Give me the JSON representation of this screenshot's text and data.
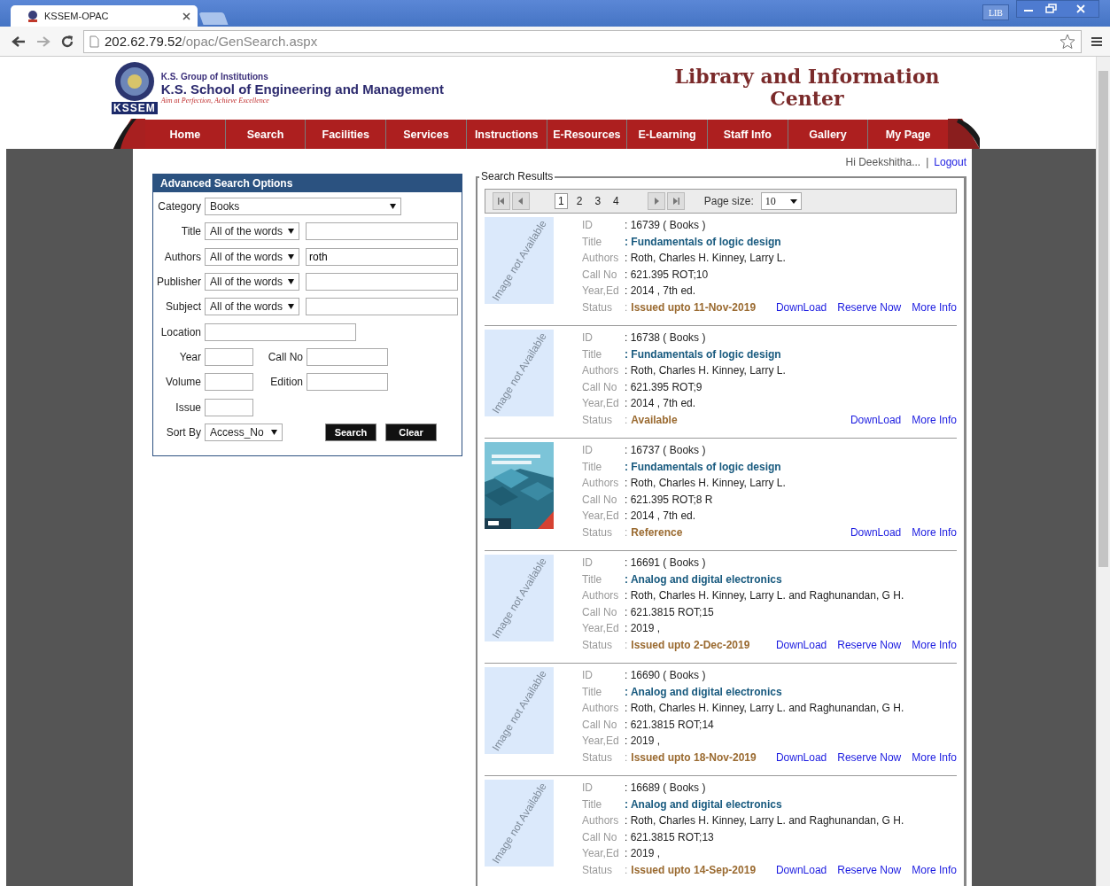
{
  "browser": {
    "tab_title": "KSSEM-OPAC",
    "profile": "LIB",
    "url_host": "202.62.79.52",
    "url_path": "/opac/GenSearch.aspx"
  },
  "header": {
    "group": "K.S. Group of Institutions",
    "school": "K.S. School of Engineering and Management",
    "motto": "Aim at Perfection, Achieve Excellence",
    "logo_text": "KSSEM",
    "title": "Library and Information Center"
  },
  "nav": [
    "Home",
    "Search",
    "Facilities",
    "Services",
    "Instructions",
    "E-Resources",
    "E-Learning",
    "Staff Info",
    "Gallery",
    "My Page"
  ],
  "user": {
    "greeting": "Hi Deekshitha...",
    "separator": "|",
    "logout": "Logout"
  },
  "search_panel": {
    "title": "Advanced Search Options",
    "category": {
      "label": "Category",
      "value": "Books"
    },
    "word_fields": [
      {
        "label": "Title",
        "mode": "All of the words"
      },
      {
        "label": "Authors",
        "mode": "All of the words",
        "value": "roth"
      },
      {
        "label": "Publisher",
        "mode": "All of the words"
      },
      {
        "label": "Subject",
        "mode": "All of the words"
      }
    ],
    "location": {
      "label": "Location"
    },
    "pairs": [
      {
        "left": "Year",
        "right": "Call No"
      },
      {
        "left": "Volume",
        "right": "Edition"
      }
    ],
    "issue": {
      "label": "Issue"
    },
    "sort": {
      "label": "Sort By",
      "value": "Access_No"
    },
    "buttons": [
      "Search",
      "Clear"
    ]
  },
  "results": {
    "legend": "Search Results",
    "pages": [
      {
        "label": "1",
        "selected": true
      },
      {
        "label": "2",
        "selected": false
      },
      {
        "label": "3",
        "selected": false
      },
      {
        "label": "4",
        "selected": false
      }
    ],
    "page_size_label": "Page size:",
    "page_size": "10",
    "items": [
      {
        "image": {
          "kind": "placeholder",
          "text": "Image not Available"
        },
        "fields": [
          {
            "label": "ID",
            "value": ": 16739 ( Books  )"
          },
          {
            "label": "Title",
            "value": ": Fundamentals of logic design"
          },
          {
            "label": "Authors",
            "value": ": Roth, Charles H. Kinney, Larry L."
          },
          {
            "label": "Call No",
            "value": ": 621.395 ROT;10"
          },
          {
            "label": "Year,Ed",
            "value": ": 2014  ,  7th ed."
          }
        ],
        "status": {
          "label": "Status",
          "colon": ":",
          "value": "Issued upto 11-Nov-2019"
        },
        "actions": [
          "DownLoad",
          "Reserve Now",
          "More Info"
        ]
      },
      {
        "image": {
          "kind": "placeholder",
          "text": "Image not Available"
        },
        "fields": [
          {
            "label": "ID",
            "value": ": 16738 ( Books  )"
          },
          {
            "label": "Title",
            "value": ": Fundamentals of logic design"
          },
          {
            "label": "Authors",
            "value": ": Roth, Charles H. Kinney, Larry L."
          },
          {
            "label": "Call No",
            "value": ": 621.395 ROT;9"
          },
          {
            "label": "Year,Ed",
            "value": ": 2014  ,  7th ed."
          }
        ],
        "status": {
          "label": "Status",
          "colon": ":",
          "value": "Available"
        },
        "actions": [
          "DownLoad",
          "More Info"
        ]
      },
      {
        "image": {
          "kind": "picture"
        },
        "fields": [
          {
            "label": "ID",
            "value": ": 16737 ( Books  )"
          },
          {
            "label": "Title",
            "value": ": Fundamentals of logic design"
          },
          {
            "label": "Authors",
            "value": ": Roth, Charles H. Kinney, Larry L."
          },
          {
            "label": "Call No",
            "value": ": 621.395 ROT;8 R"
          },
          {
            "label": "Year,Ed",
            "value": ": 2014  ,  7th ed."
          }
        ],
        "status": {
          "label": "Status",
          "colon": ":",
          "value": "Reference"
        },
        "actions": [
          "DownLoad",
          "More Info"
        ]
      },
      {
        "image": {
          "kind": "placeholder",
          "text": "Image not Available"
        },
        "fields": [
          {
            "label": "ID",
            "value": ": 16691 ( Books  )"
          },
          {
            "label": "Title",
            "value": ": Analog and digital electronics"
          },
          {
            "label": "Authors",
            "value": ": Roth, Charles H. Kinney, Larry L. and Raghunandan, G H."
          },
          {
            "label": "Call No",
            "value": ": 621.3815 ROT;15"
          },
          {
            "label": "Year,Ed",
            "value": ": 2019  ,"
          }
        ],
        "status": {
          "label": "Status",
          "colon": ":",
          "value": "Issued upto 2-Dec-2019"
        },
        "actions": [
          "DownLoad",
          "Reserve Now",
          "More Info"
        ]
      },
      {
        "image": {
          "kind": "placeholder",
          "text": "Image not Available"
        },
        "fields": [
          {
            "label": "ID",
            "value": ": 16690 ( Books  )"
          },
          {
            "label": "Title",
            "value": ": Analog and digital electronics"
          },
          {
            "label": "Authors",
            "value": ": Roth, Charles H. Kinney, Larry L. and Raghunandan, G H."
          },
          {
            "label": "Call No",
            "value": ": 621.3815 ROT;14"
          },
          {
            "label": "Year,Ed",
            "value": ": 2019  ,"
          }
        ],
        "status": {
          "label": "Status",
          "colon": ":",
          "value": "Issued upto 18-Nov-2019"
        },
        "actions": [
          "DownLoad",
          "Reserve Now",
          "More Info"
        ]
      },
      {
        "image": {
          "kind": "placeholder",
          "text": "Image not Available"
        },
        "fields": [
          {
            "label": "ID",
            "value": ": 16689 ( Books  )"
          },
          {
            "label": "Title",
            "value": ": Analog and digital electronics"
          },
          {
            "label": "Authors",
            "value": ": Roth, Charles H. Kinney, Larry L. and Raghunandan, G H."
          },
          {
            "label": "Call No",
            "value": ": 621.3815 ROT;13"
          },
          {
            "label": "Year,Ed",
            "value": ": 2019  ,"
          }
        ],
        "status": {
          "label": "Status",
          "colon": ":",
          "value": "Issued upto 14-Sep-2019"
        },
        "actions": [
          "DownLoad",
          "Reserve Now",
          "More Info"
        ]
      }
    ]
  }
}
